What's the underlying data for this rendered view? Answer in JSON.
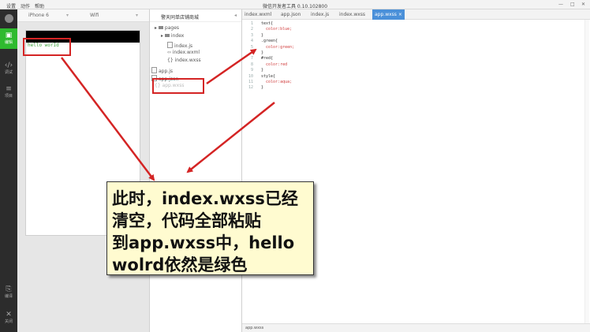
{
  "window": {
    "title": "微信开发者工具 0.10.102800",
    "menu": [
      "设置",
      "动作",
      "帮助"
    ],
    "controls": [
      "—",
      "□",
      "✕"
    ]
  },
  "leftbar": {
    "items": [
      {
        "label": "编辑",
        "icon": "code-icon"
      },
      {
        "label": "调试",
        "icon": "debug-icon"
      },
      {
        "label": "项目",
        "icon": "project-icon"
      },
      {
        "label": "编译",
        "icon": "compile-icon"
      },
      {
        "label": "关闭",
        "icon": "close-icon"
      }
    ]
  },
  "simulator": {
    "device": "iPhone 6",
    "network": "Wifi",
    "page_text": "hello worId"
  },
  "filetree": {
    "project_name": "警天同单店铺商城",
    "entries": [
      "pages",
      "index",
      "index.js",
      "index.wxml",
      "index.wxss",
      "app.js",
      "app.json",
      "app.wxss"
    ]
  },
  "editor": {
    "tabs": [
      "index.wxml",
      "app.json",
      "index.js",
      "index.wxss",
      "app.wxss"
    ],
    "active_tab": "app.wxss",
    "lines": [
      {
        "n": "1",
        "text": "text{"
      },
      {
        "n": "2",
        "text": "  color:blue;"
      },
      {
        "n": "3",
        "text": "}"
      },
      {
        "n": "4",
        "text": ".green{"
      },
      {
        "n": "5",
        "text": "  color:green;"
      },
      {
        "n": "6",
        "text": "}"
      },
      {
        "n": "7",
        "text": "#red{"
      },
      {
        "n": "8",
        "text": "  color:red"
      },
      {
        "n": "9",
        "text": "}"
      },
      {
        "n": "10",
        "text": "style{"
      },
      {
        "n": "11",
        "text": "  color:aqua;"
      },
      {
        "n": "12",
        "text": "}"
      }
    ],
    "status": "app.wxss"
  },
  "callout": {
    "lines": [
      "此时，index.wxss已经",
      "清空，代码全部粘贴",
      "到app.wxss中，hello",
      "wolrd依然是绿色"
    ]
  },
  "colors": {
    "accent": "#2fba2f",
    "annotation": "#d42424",
    "callout_bg": "#fffbd0",
    "tab_active": "#4a90d9"
  }
}
